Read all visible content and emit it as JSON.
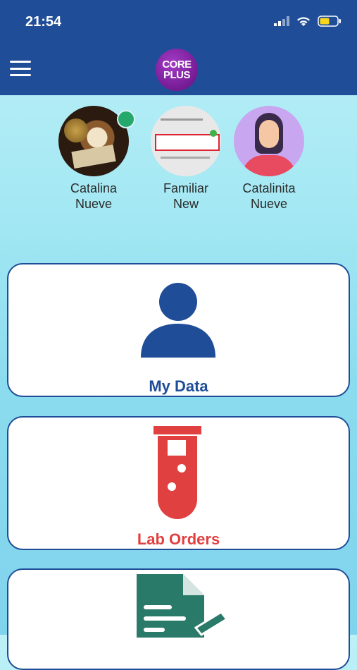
{
  "status_bar": {
    "time": "21:54",
    "icons": [
      "signal-icon",
      "wifi-icon",
      "battery-icon"
    ]
  },
  "app_bar": {
    "logo_top": "CORE",
    "logo_bottom": "PLUS",
    "menu_icon": "hamburger-menu-icon"
  },
  "profiles": [
    {
      "line1": "Catalina",
      "line2": "Nueve",
      "online": true
    },
    {
      "line1": "Familiar",
      "line2": "New"
    },
    {
      "line1": "Catalinita",
      "line2": "Nueve"
    }
  ],
  "cards": {
    "my_data": {
      "label": "My Data",
      "icon": "person-icon",
      "color": "#1f4d98"
    },
    "lab_orders": {
      "label": "Lab Orders",
      "icon": "test-tube-icon",
      "color": "#e04040"
    },
    "third": {
      "icon": "document-edit-icon",
      "color": "#2a7a6a"
    }
  },
  "colors": {
    "brand": "#1f4d98",
    "accent_red": "#e04040",
    "logo": "#7b1f9c"
  }
}
